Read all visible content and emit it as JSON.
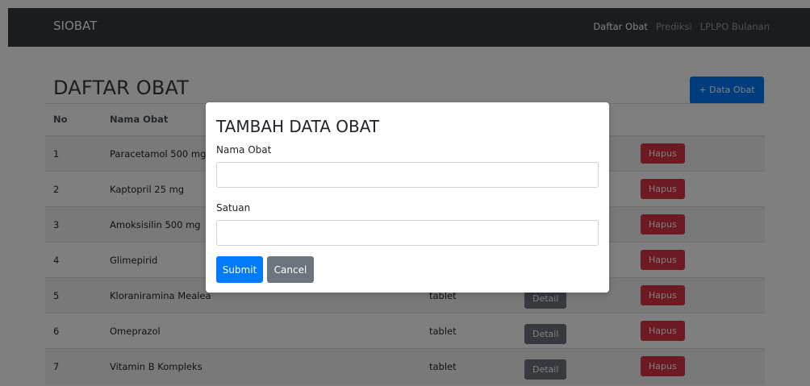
{
  "navbar": {
    "brand": "SIOBAT",
    "links": [
      {
        "label": "Daftar Obat",
        "active": true
      },
      {
        "label": "Prediksi",
        "active": false
      },
      {
        "label": "LPLPO Bulanan",
        "active": false
      }
    ]
  },
  "page": {
    "title": "DAFTAR OBAT",
    "add_button": "+ Data Obat"
  },
  "table": {
    "headers": [
      "No",
      "Nama Obat"
    ],
    "detail_label": "Detail",
    "hapus_label": "Hapus",
    "rows": [
      {
        "no": "1",
        "nama": "Paracetamol 500 mg",
        "satuan": ""
      },
      {
        "no": "2",
        "nama": "Kaptopril 25 mg",
        "satuan": ""
      },
      {
        "no": "3",
        "nama": "Amoksisilin 500 mg",
        "satuan": ""
      },
      {
        "no": "4",
        "nama": "Glimepirid",
        "satuan": ""
      },
      {
        "no": "5",
        "nama": "Kloraniramina Mealea",
        "satuan": "tablet"
      },
      {
        "no": "6",
        "nama": "Omeprazol",
        "satuan": "tablet"
      },
      {
        "no": "7",
        "nama": "Vitamin B Kompleks",
        "satuan": "tablet"
      }
    ]
  },
  "modal": {
    "title": "TAMBAH DATA OBAT",
    "nama_label": "Nama Obat",
    "nama_value": "",
    "satuan_label": "Satuan",
    "satuan_value": "",
    "submit_label": "Submit",
    "cancel_label": "Cancel"
  },
  "colors": {
    "primary": "#007bff",
    "secondary": "#6c757d",
    "danger": "#dc3545",
    "navbar": "#343a40"
  }
}
